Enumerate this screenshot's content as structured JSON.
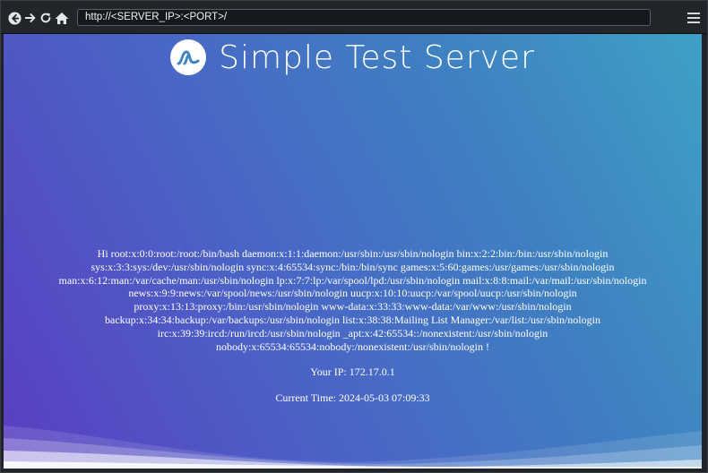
{
  "browser": {
    "url": "http://<SERVER_IP>:<PORT>/",
    "icons": {
      "back": "back-arrow-icon",
      "forward": "forward-arrow-icon",
      "reload": "reload-icon",
      "home": "home-icon",
      "menu": "hamburger-menu-icon"
    }
  },
  "page": {
    "title": "Simple Test Server",
    "logo": "wave-logo-icon",
    "passwd_text": "Hi root:x:0:0:root:/root:/bin/bash daemon:x:1:1:daemon:/usr/sbin:/usr/sbin/nologin bin:x:2:2:bin:/bin:/usr/sbin/nologin\nsys:x:3:3:sys:/dev:/usr/sbin/nologin sync:x:4:65534:sync:/bin:/bin/sync games:x:5:60:games:/usr/games:/usr/sbin/nologin\nman:x:6:12:man:/var/cache/man:/usr/sbin/nologin lp:x:7:7:lp:/var/spool/lpd:/usr/sbin/nologin mail:x:8:8:mail:/var/mail:/usr/sbin/nologin\nnews:x:9:9:news:/var/spool/news:/usr/sbin/nologin uucp:x:10:10:uucp:/var/spool/uucp:/usr/sbin/nologin\nproxy:x:13:13:proxy:/bin:/usr/sbin/nologin www-data:x:33:33:www-data:/var/www:/usr/sbin/nologin\nbackup:x:34:34:backup:/var/backups:/usr/sbin/nologin list:x:38:38:Mailing List Manager:/var/list:/usr/sbin/nologin\nirc:x:39:39:ircd:/run/ircd:/usr/sbin/nologin _apt:x:42:65534::/nonexistent:/usr/sbin/nologin\nnobody:x:65534:65534:nobody:/nonexistent:/usr/sbin/nologin !",
    "ip_line": "Your IP: 172.17.0.1",
    "time_line": "Current Time: 2024-05-03 07:09:33"
  },
  "colors": {
    "gradient_start": "#5a3ec2",
    "gradient_mid": "#4a64c6",
    "gradient_end": "#3fa0c6",
    "toolbar": "#22262b"
  }
}
